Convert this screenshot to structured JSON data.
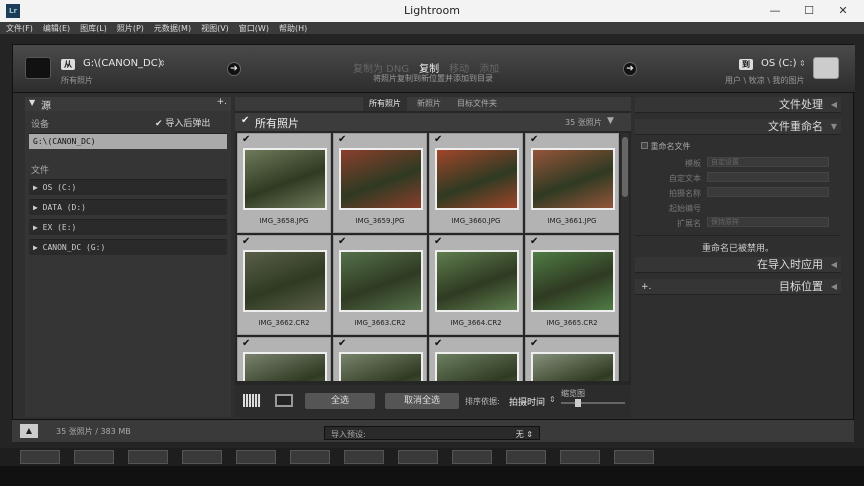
{
  "window": {
    "title": "Lightroom",
    "app_icon": "Lr",
    "minimize": "—",
    "maximize": "☐",
    "close": "✕"
  },
  "menu": [
    "文件(F)",
    "编辑(E)",
    "图库(L)",
    "照片(P)",
    "元数据(M)",
    "视图(V)",
    "窗口(W)",
    "帮助(H)"
  ],
  "source": {
    "from_label": "从",
    "path": "G:\\(CANON_DC)",
    "sub": "所有照片",
    "caret": "⇕"
  },
  "modes": {
    "items": [
      "复制为 DNG",
      "复制",
      "移动",
      "添加"
    ],
    "active": "复制",
    "description": "将照片复制到新位置并添加到目录"
  },
  "destination": {
    "to_label": "到",
    "drive": "OS (C:)",
    "path": "用户 \\ 牧凉 \\ 我的图片",
    "caret": "⇕"
  },
  "left_panel": {
    "title": "源",
    "plus": "+.",
    "device_label": "设备",
    "eject_label": "导入后弹出",
    "device_path": "G:\\(CANON_DC)",
    "files_label": "文件",
    "drives": [
      "OS (C:)",
      "DATA (D:)",
      "EX (E:)",
      "CANON_DC (G:)"
    ]
  },
  "view_tabs": {
    "items": [
      "所有照片",
      "新照片",
      "目标文件夹"
    ],
    "active": "所有照片"
  },
  "grid_header": {
    "title": "所有照片",
    "count": "35 张照片"
  },
  "photos": [
    {
      "name": "IMG_3658.JPG",
      "color": "#6f7a5a"
    },
    {
      "name": "IMG_3659.JPG",
      "color": "#8a3f2c"
    },
    {
      "name": "IMG_3660.JPG",
      "color": "#a0462a"
    },
    {
      "name": "IMG_3661.JPG",
      "color": "#94553a"
    },
    {
      "name": "IMG_3662.CR2",
      "color": "#5a5f48"
    },
    {
      "name": "IMG_3663.CR2",
      "color": "#55714a"
    },
    {
      "name": "IMG_3664.CR2",
      "color": "#5f7e4e"
    },
    {
      "name": "IMG_3665.CR2",
      "color": "#4f7c45"
    },
    {
      "name": "",
      "color": "#7a826e"
    },
    {
      "name": "",
      "color": "#77836a"
    },
    {
      "name": "",
      "color": "#6c7f60"
    },
    {
      "name": "",
      "color": "#85907a"
    }
  ],
  "toolbar": {
    "select_all": "全选",
    "deselect_all": "取消全选",
    "sort_label": "排序依据:",
    "sort_value": "拍摄时间",
    "sort_caret": "⇕",
    "thumb_label": "缩览图"
  },
  "right_panel": {
    "file_handling": "文件处理",
    "file_rename": "文件重命名",
    "rename_checkbox": "重命名文件",
    "fields": [
      {
        "label": "模板",
        "value": "自定设置"
      },
      {
        "label": "自定文本",
        "value": ""
      },
      {
        "label": "拍摄名称",
        "value": ""
      },
      {
        "label": "起始编号",
        "value": ""
      },
      {
        "label": "扩展名",
        "value": "保持原样"
      }
    ],
    "rename_disabled": "重命名已被禁用。",
    "apply_during_import": "在导入时应用",
    "destination": "目标位置",
    "dest_plus": "+."
  },
  "footer": {
    "collapse": "▲",
    "summary": "35 张照片 / 383 MB",
    "preset_label": "导入预设:",
    "preset_value": "无 ⇕"
  }
}
